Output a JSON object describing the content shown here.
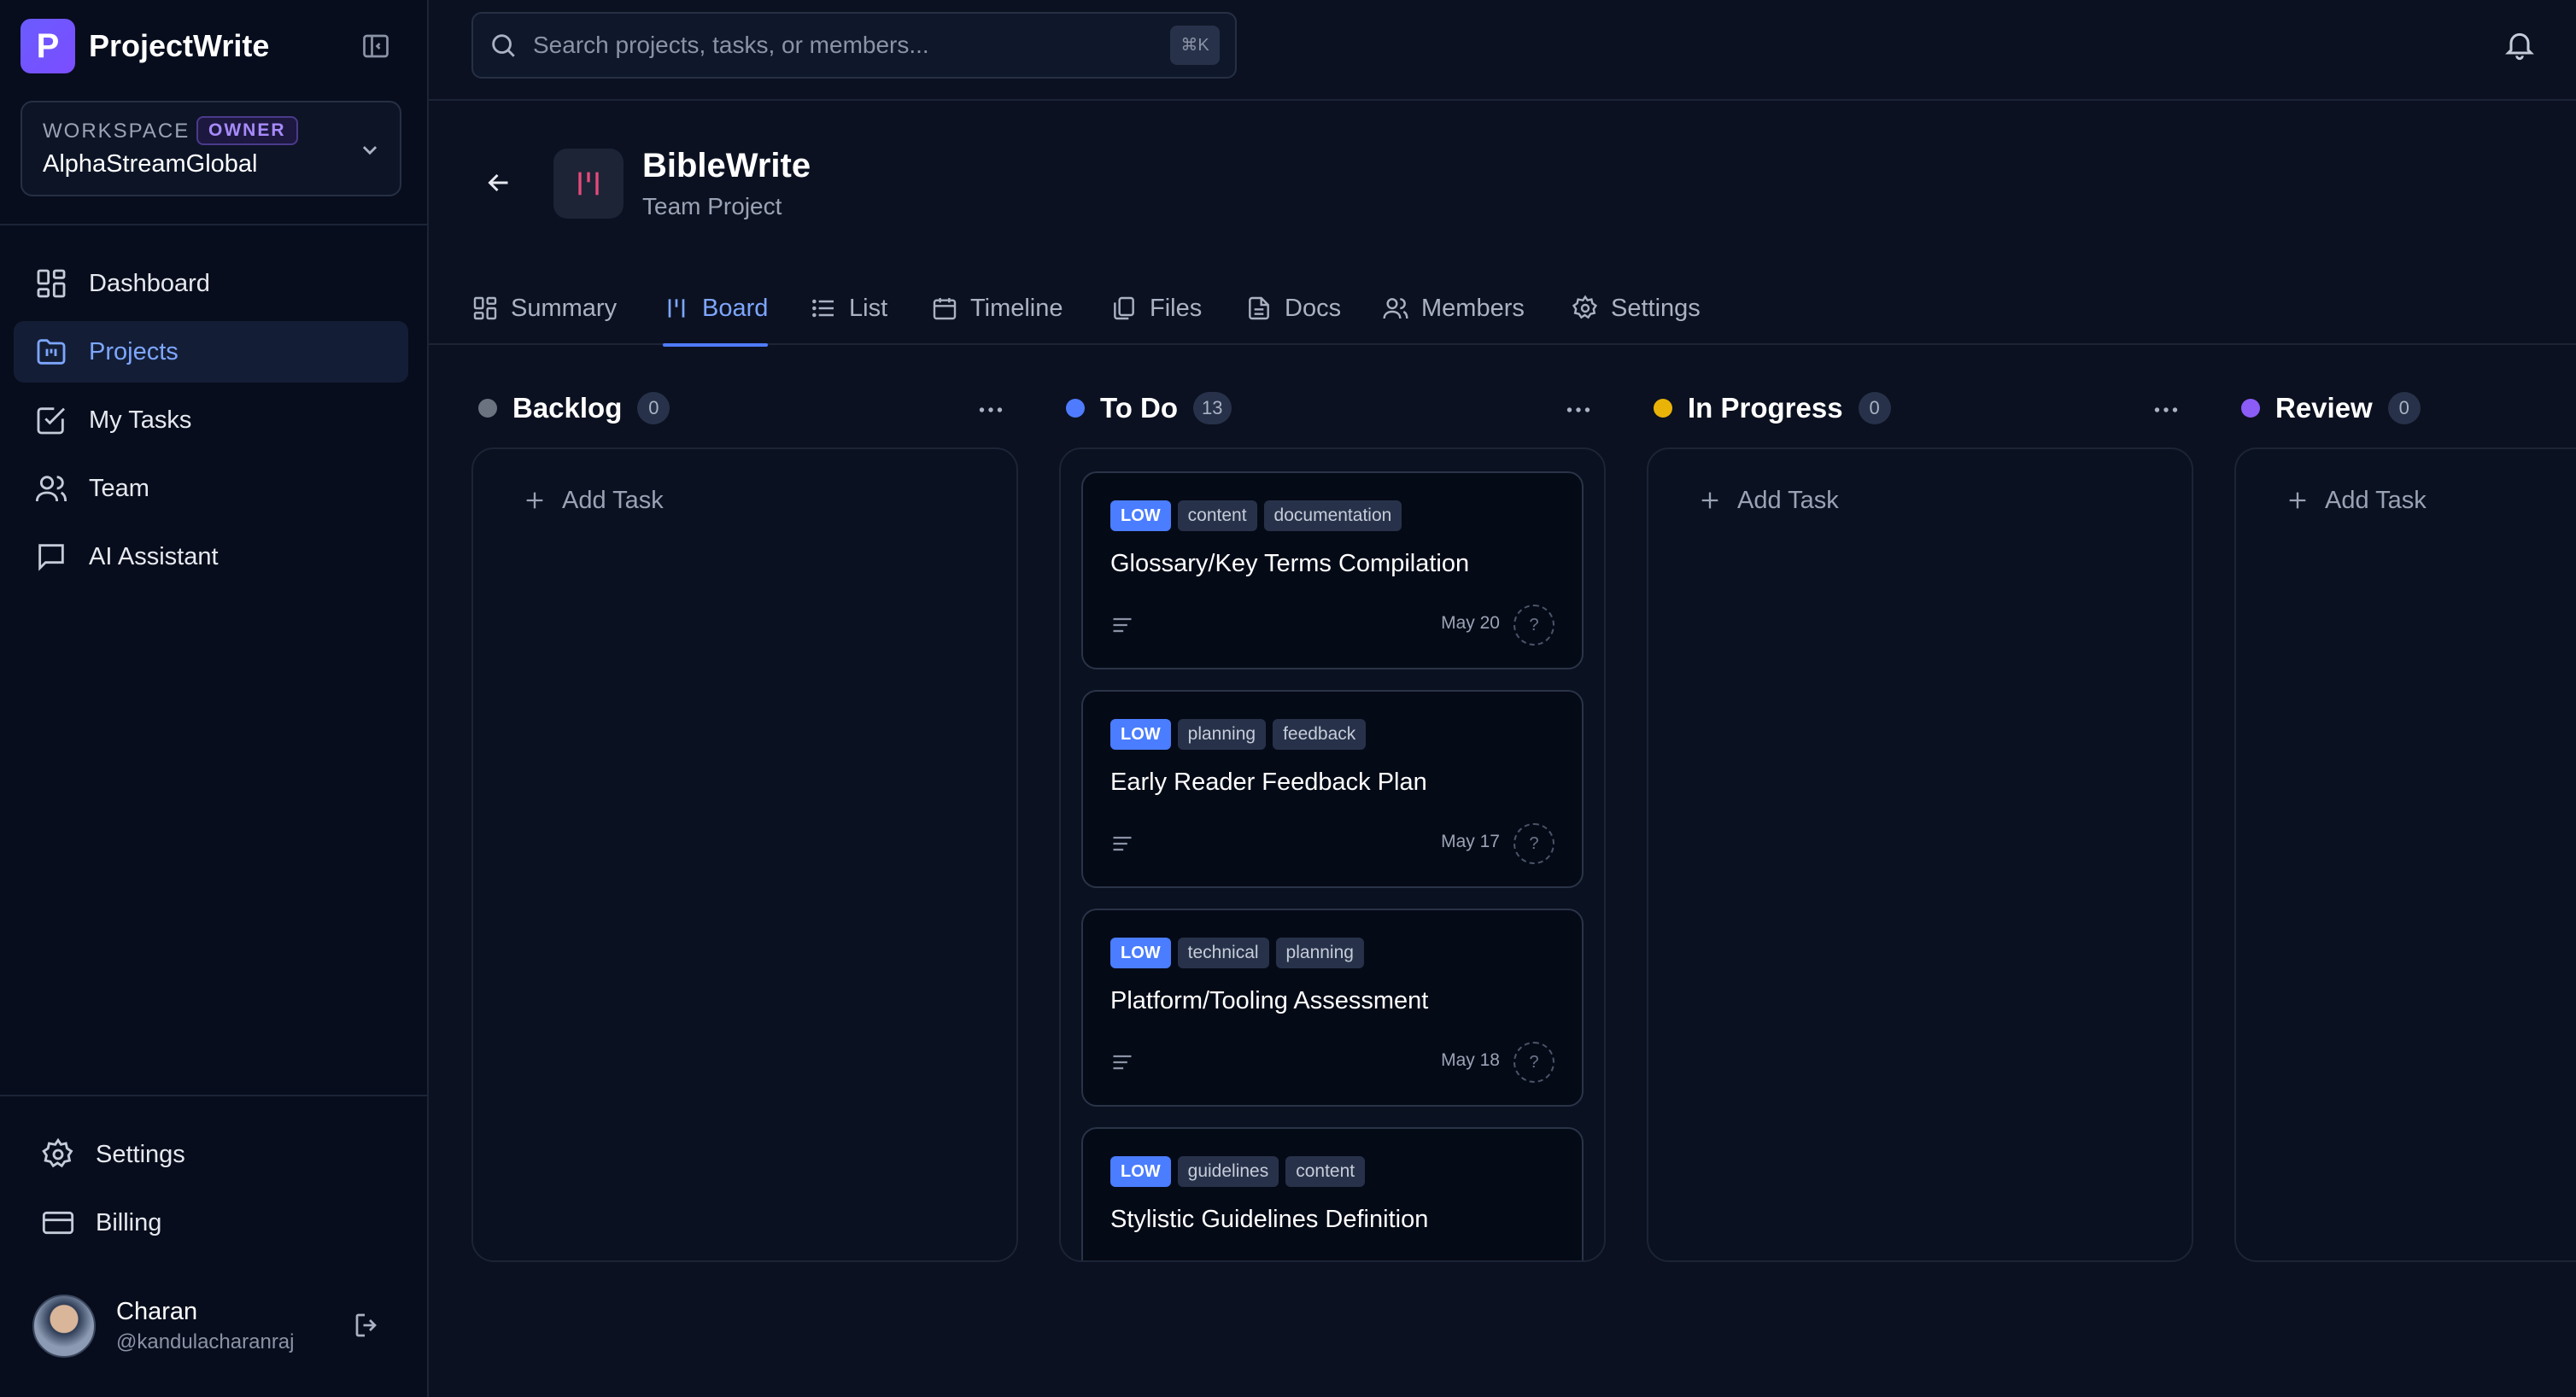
{
  "brand": {
    "logo_letter": "P",
    "name": "ProjectWrite"
  },
  "workspace": {
    "label": "WORKSPACE",
    "badge": "OWNER",
    "name": "AlphaStreamGlobal"
  },
  "nav": {
    "items": [
      {
        "label": "Dashboard",
        "icon": "dashboard-icon"
      },
      {
        "label": "Projects",
        "icon": "projects-icon",
        "active": true
      },
      {
        "label": "My Tasks",
        "icon": "tasks-icon"
      },
      {
        "label": "Team",
        "icon": "team-icon"
      },
      {
        "label": "AI Assistant",
        "icon": "chat-icon"
      }
    ],
    "bottom": [
      {
        "label": "Settings",
        "icon": "gear-icon"
      },
      {
        "label": "Billing",
        "icon": "card-icon"
      }
    ]
  },
  "user": {
    "name": "Charan",
    "handle": "@kandulacharanraj"
  },
  "search": {
    "placeholder": "Search projects, tasks, or members...",
    "shortcut": "⌘K"
  },
  "project": {
    "title": "BibleWrite",
    "subtitle": "Team Project"
  },
  "tabs": [
    {
      "label": "Summary",
      "icon": "grid-icon"
    },
    {
      "label": "Board",
      "icon": "board-icon",
      "active": true
    },
    {
      "label": "List",
      "icon": "list-icon"
    },
    {
      "label": "Timeline",
      "icon": "calendar-icon"
    },
    {
      "label": "Files",
      "icon": "files-icon"
    },
    {
      "label": "Docs",
      "icon": "doc-icon"
    },
    {
      "label": "Members",
      "icon": "members-icon"
    },
    {
      "label": "Settings",
      "icon": "gear-icon"
    }
  ],
  "board": {
    "add_task_label": "Add Task",
    "columns": [
      {
        "title": "Backlog",
        "count": "0",
        "color": "#6b7280"
      },
      {
        "title": "To Do",
        "count": "13",
        "color": "#4f7cff"
      },
      {
        "title": "In Progress",
        "count": "0",
        "color": "#eab308"
      },
      {
        "title": "Review",
        "count": "0",
        "color": "#8b5cf6"
      }
    ],
    "todo_cards": [
      {
        "priority": "LOW",
        "tags": [
          "content",
          "documentation"
        ],
        "title": "Glossary/Key Terms Compilation",
        "date": "May 20",
        "assignee": "?"
      },
      {
        "priority": "LOW",
        "tags": [
          "planning",
          "feedback"
        ],
        "title": "Early Reader Feedback Plan",
        "date": "May 17",
        "assignee": "?"
      },
      {
        "priority": "LOW",
        "tags": [
          "technical",
          "planning"
        ],
        "title": "Platform/Tooling Assessment",
        "date": "May 18",
        "assignee": "?"
      },
      {
        "priority": "LOW",
        "tags": [
          "guidelines",
          "content"
        ],
        "title": "Stylistic Guidelines Definition",
        "date": "",
        "assignee": "?"
      }
    ]
  }
}
